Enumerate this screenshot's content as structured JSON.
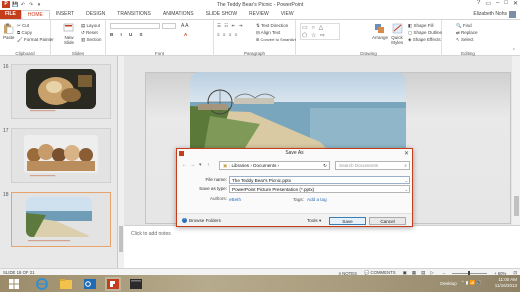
{
  "window": {
    "title": "The Teddy Bear's Picnic - PowerPoint",
    "controls": [
      "?",
      "▭",
      "–",
      "□",
      "✕"
    ]
  },
  "qat": {
    "app_icon": "P",
    "save": "💾",
    "undo": "↶",
    "redo": "↷",
    "start": "▾"
  },
  "ribbon_tabs": [
    "FILE",
    "HOME",
    "INSERT",
    "DESIGN",
    "TRANSITIONS",
    "ANIMATIONS",
    "SLIDE SHOW",
    "REVIEW",
    "VIEW"
  ],
  "user": {
    "name": "Elizabeth Nohs"
  },
  "ribbon": {
    "clipboard": {
      "label": "Clipboard",
      "paste": "Paste",
      "cut": "Cut",
      "copy": "Copy",
      "format_painter": "Format Painter"
    },
    "slides": {
      "label": "Slides",
      "new_slide": "New Slide",
      "layout": "Layout",
      "reset": "Reset",
      "section": "Section"
    },
    "font": {
      "label": "Font"
    },
    "paragraph": {
      "label": "Paragraph",
      "text_direction": "Text Direction",
      "align_text": "Align Text",
      "convert_smartart": "Convert to SmartArt"
    },
    "drawing": {
      "label": "Drawing",
      "arrange": "Arrange",
      "quick_styles": "Quick Styles",
      "shape_fill": "Shape Fill",
      "shape_outline": "Shape Outline",
      "shape_effects": "Shape Effects"
    },
    "editing": {
      "label": "Editing",
      "find": "Find",
      "replace": "Replace",
      "select": "Select"
    }
  },
  "slides": [
    {
      "number": "16",
      "caption": ""
    },
    {
      "number": "17",
      "caption": ""
    },
    {
      "number": "18",
      "caption": ""
    }
  ],
  "notes_placeholder": "Click to add notes",
  "status": {
    "slide_info": "SLIDE 18 OF 21",
    "notes": "NOTES",
    "comments": "COMMENTS",
    "zoom": "+ 60%"
  },
  "taskbar": {
    "desktop": "Desktop",
    "time": "11:00 AM",
    "date": "11/16/2013"
  },
  "dialog": {
    "title": "Save As",
    "close": "✕",
    "path": [
      "Libraries",
      "Documents"
    ],
    "search_placeholder": "Search Documents",
    "file_name_label": "File name:",
    "file_name_value": "The Teddy Bear's Picnic.pptx",
    "save_type_label": "Save as type:",
    "save_type_value": "PowerPoint Picture Presentation (*.pptx)",
    "authors_label": "Authors:",
    "authors_value": "eBeth",
    "tags_label": "Tags:",
    "tags_value": "Add a tag",
    "browse_folders": "Browse Folders",
    "tools": "Tools",
    "save": "Save",
    "cancel": "Cancel"
  },
  "colors": {
    "accent": "#c43e1c",
    "link": "#2a6ebb"
  }
}
